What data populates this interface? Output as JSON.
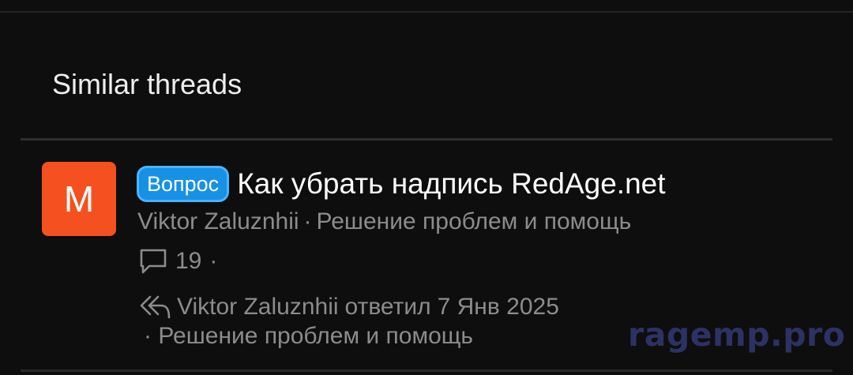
{
  "section": {
    "title": "Similar threads"
  },
  "thread": {
    "avatar_letter": "M",
    "avatar_color": "#f5501f",
    "prefix": "Вопрос",
    "prefix_color": "#1791e6",
    "title": "Как убрать надпись RedAge.net",
    "author": "Viktor Zaluznhii",
    "separator": "·",
    "forum": "Решение проблем и помощь",
    "replies": "19",
    "stats_separator": "·",
    "comment_icon": "comment-icon",
    "reply_icon": "reply-icon",
    "last_reply": {
      "user": "Viktor Zaluznhii",
      "action": "ответил",
      "date": "7 Янв 2025",
      "forum_separator": "·",
      "forum": "Решение проблем и помощь"
    }
  },
  "watermark": "ragemp.pro"
}
